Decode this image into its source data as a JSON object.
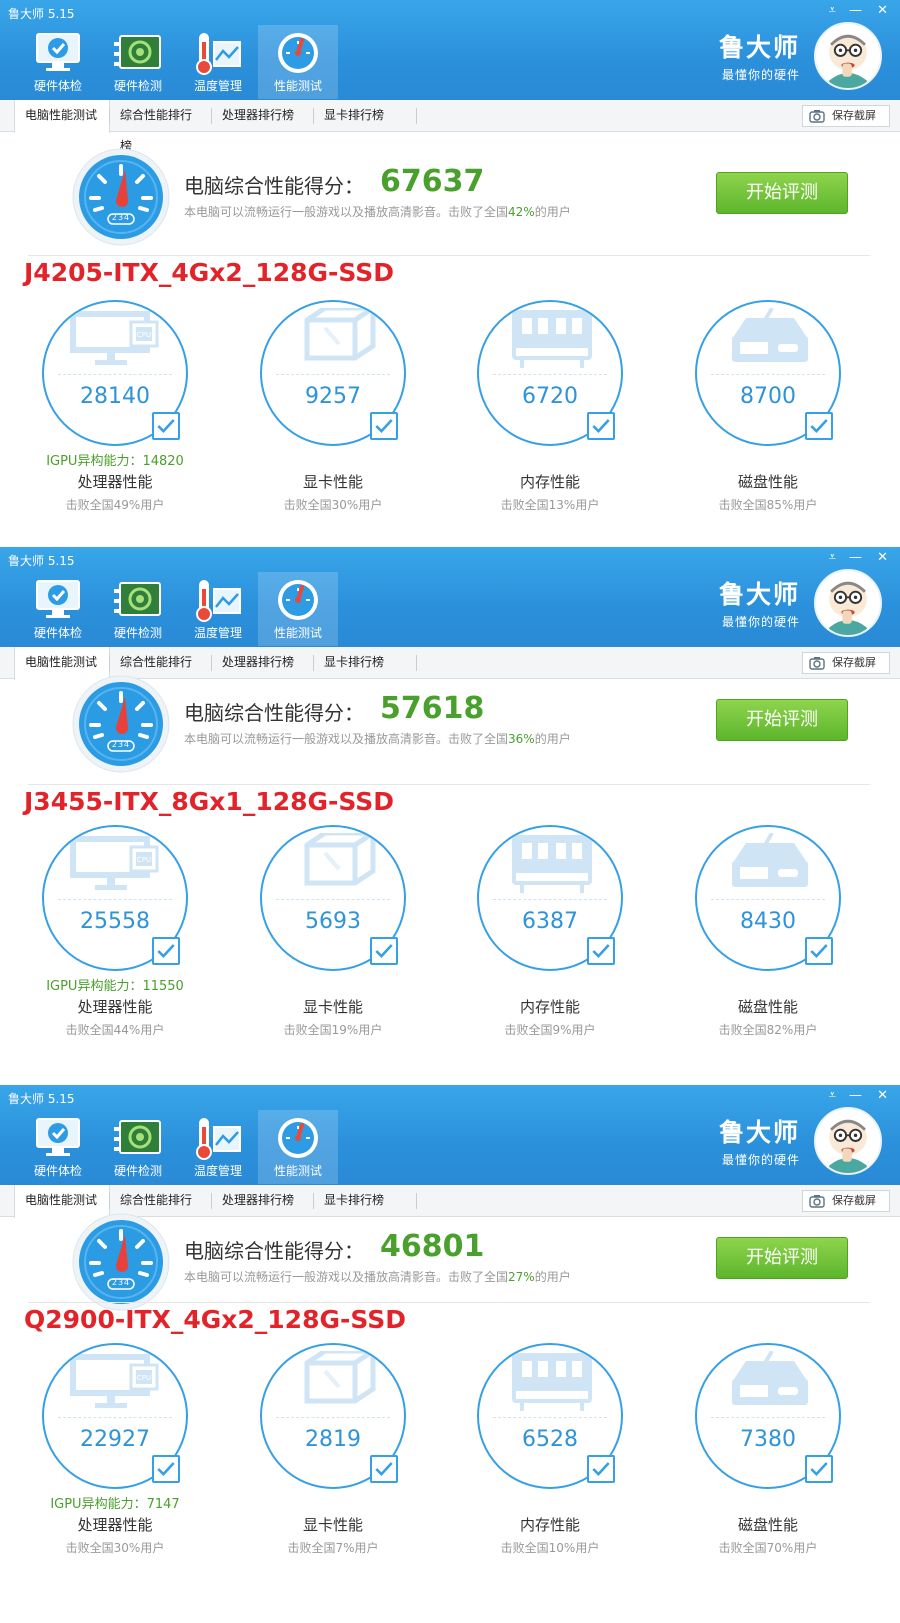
{
  "app": {
    "title": "鲁大师 5.15",
    "brand_name": "鲁大师",
    "brand_slogan": "最懂你的硬件",
    "menu_glyph": "⩡",
    "min_glyph": "—",
    "close_glyph": "✕",
    "tools": [
      {
        "label": "硬件体检",
        "icon": "monitor-check-icon"
      },
      {
        "label": "硬件检测",
        "icon": "circuit-board-icon"
      },
      {
        "label": "温度管理",
        "icon": "thermometer-icon"
      },
      {
        "label": "性能测试",
        "icon": "speedometer-icon"
      }
    ],
    "tabs": [
      "电脑性能测试",
      "综合性能排行榜",
      "处理器排行榜",
      "显卡排行榜"
    ],
    "screenshot_label": "保存截屏",
    "score_title": "电脑综合性能得分：",
    "desc_prefix": "本电脑可以流畅运行一般游戏以及播放高清影音。击败了全国",
    "desc_suffix": "的用户",
    "start_label": "开始评测",
    "gauge_text": "234",
    "comp_names": [
      "处理器性能",
      "显卡性能",
      "内存性能",
      "磁盘性能"
    ],
    "igpu_prefix": "IGPU异构能力：",
    "beat_prefix": "击败全国",
    "beat_suffix": "用户"
  },
  "colors": {
    "header": "#2b90db",
    "accent_blue": "#35a0e6",
    "score_green": "#4aa02c",
    "config_red": "#e3232a"
  },
  "panels": [
    {
      "config": "J4205-ITX_4Gx2_128G-SSD",
      "score": "67637",
      "beat_pct": "42%",
      "igpu": "14820",
      "components": [
        {
          "value": "28140",
          "beat": "49%"
        },
        {
          "value": "9257",
          "beat": "30%"
        },
        {
          "value": "6720",
          "beat": "13%"
        },
        {
          "value": "8700",
          "beat": "85%"
        }
      ]
    },
    {
      "config": "J3455-ITX_8Gx1_128G-SSD",
      "score": "57618",
      "beat_pct": "36%",
      "igpu": "11550",
      "components": [
        {
          "value": "25558",
          "beat": "44%"
        },
        {
          "value": "5693",
          "beat": "19%"
        },
        {
          "value": "6387",
          "beat": "9%"
        },
        {
          "value": "8430",
          "beat": "82%"
        }
      ]
    },
    {
      "config": "Q2900-ITX_4Gx2_128G-SSD",
      "score": "46801",
      "beat_pct": "27%",
      "igpu": "7147",
      "components": [
        {
          "value": "22927",
          "beat": "30%"
        },
        {
          "value": "2819",
          "beat": "7%"
        },
        {
          "value": "6528",
          "beat": "10%"
        },
        {
          "value": "7380",
          "beat": "70%"
        }
      ]
    }
  ]
}
